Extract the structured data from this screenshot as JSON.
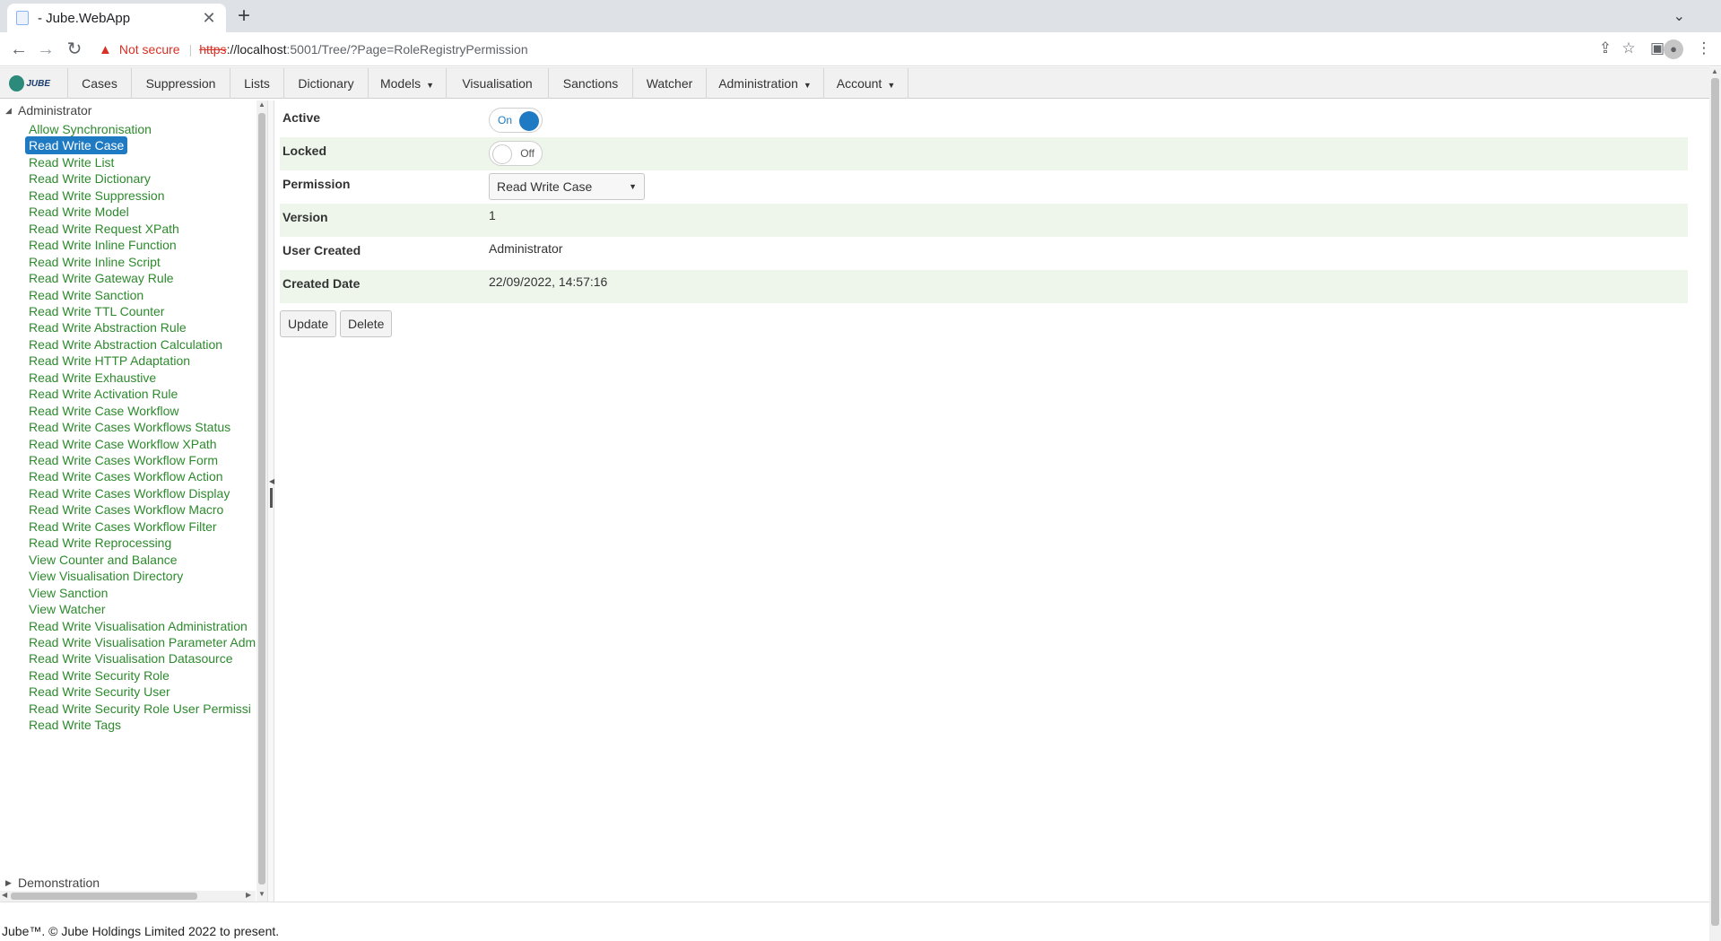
{
  "browser": {
    "tab_title": "- Jube.WebApp",
    "tab_close": "✕",
    "new_tab": "+",
    "tab_search": "⌄",
    "security_label": "Not secure",
    "url_scheme": "https",
    "url_host": "://localhost",
    "url_path": ":5001/Tree/?Page=RoleRegistryPermission"
  },
  "menu": {
    "logo_text": "JUBE",
    "items": [
      {
        "label": "Cases"
      },
      {
        "label": "Suppression"
      },
      {
        "label": "Lists"
      },
      {
        "label": "Dictionary"
      },
      {
        "label": "Models",
        "caret": "▼"
      },
      {
        "label": "Visualisation"
      },
      {
        "label": "Sanctions"
      },
      {
        "label": "Watcher"
      },
      {
        "label": "Administration",
        "caret": "▼"
      },
      {
        "label": "Account",
        "caret": "▼"
      }
    ]
  },
  "tree": {
    "root_expanded": "Administrator",
    "root_collapsed": "Demonstration",
    "selected_index": 1,
    "items": [
      "Allow Synchronisation",
      "Read Write Case",
      "Read Write List",
      "Read Write Dictionary",
      "Read Write Suppression",
      "Read Write Model",
      "Read Write Request XPath",
      "Read Write Inline Function",
      "Read Write Inline Script",
      "Read Write Gateway Rule",
      "Read Write Sanction",
      "Read Write TTL Counter",
      "Read Write Abstraction Rule",
      "Read Write Abstraction Calculation",
      "Read Write HTTP Adaptation",
      "Read Write Exhaustive",
      "Read Write Activation Rule",
      "Read Write Case Workflow",
      "Read Write Cases Workflows Status",
      "Read Write Case Workflow XPath",
      "Read Write Cases Workflow Form",
      "Read Write Cases Workflow Action",
      "Read Write Cases Workflow Display",
      "Read Write Cases Workflow Macro",
      "Read Write Cases Workflow Filter",
      "Read Write Reprocessing",
      "View Counter and Balance",
      "View Visualisation Directory",
      "View Sanction",
      "View Watcher",
      "Read Write Visualisation Administration",
      "Read Write Visualisation Parameter Adm",
      "Read Write Visualisation Datasource",
      "Read Write Security Role",
      "Read Write Security User",
      "Read Write Security Role User Permissi",
      "Read Write Tags"
    ]
  },
  "form": {
    "active_label": "Active",
    "active_state": "On",
    "locked_label": "Locked",
    "locked_state": "Off",
    "permission_label": "Permission",
    "permission_value": "Read Write Case",
    "version_label": "Version",
    "version_value": "1",
    "user_created_label": "User Created",
    "user_created_value": "Administrator",
    "created_date_label": "Created Date",
    "created_date_value": "22/09/2022, 14:57:16",
    "update_label": "Update",
    "delete_label": "Delete"
  },
  "footer": {
    "text": "Jube™. © Jube Holdings Limited 2022 to present."
  },
  "colors": {
    "accent": "#1e7ac3",
    "tree_link": "#2d8a2d",
    "row_alt": "#eef6ec",
    "warning": "#d93025"
  }
}
